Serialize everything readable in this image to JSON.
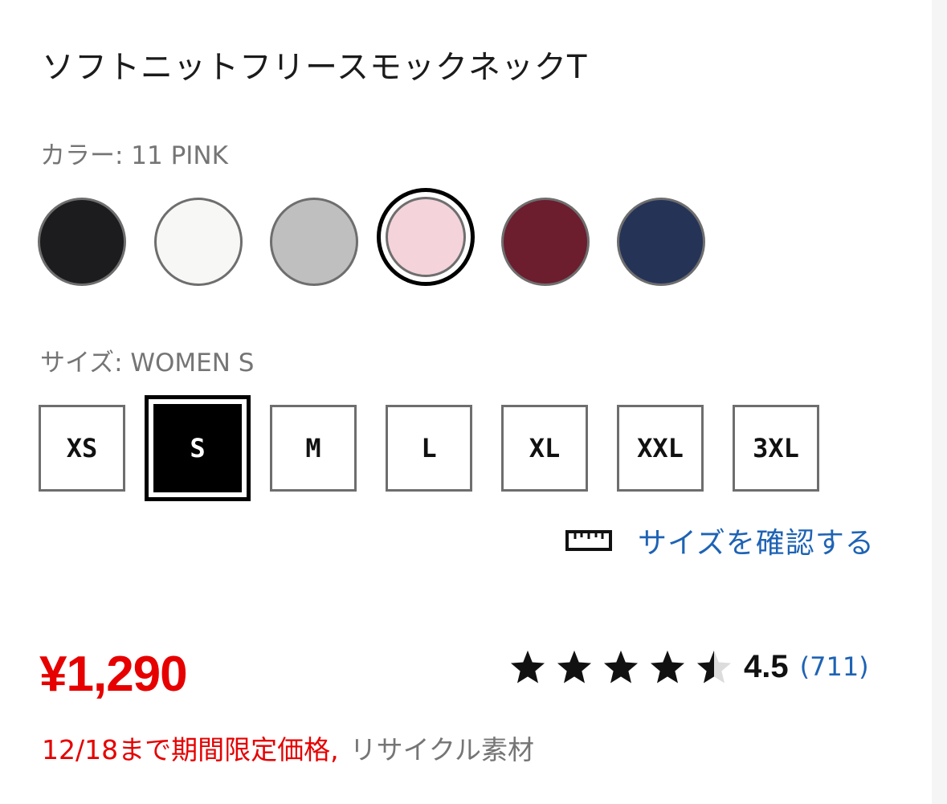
{
  "product": {
    "title": "ソフトニットフリースモックネックT"
  },
  "color": {
    "label": "カラー: 11 PINK",
    "selected_index": 3,
    "swatches": [
      {
        "name": "black",
        "hex": "#1c1c1e"
      },
      {
        "name": "off-white",
        "hex": "#f7f7f5"
      },
      {
        "name": "gray",
        "hex": "#bfbfbf"
      },
      {
        "name": "pink",
        "hex": "#f4d3db"
      },
      {
        "name": "wine",
        "hex": "#6c1d2e"
      },
      {
        "name": "navy",
        "hex": "#253357"
      }
    ]
  },
  "size": {
    "label": "サイズ: WOMEN S",
    "selected_index": 1,
    "options": [
      "XS",
      "S",
      "M",
      "L",
      "XL",
      "XXL",
      "3XL"
    ],
    "check_link": "サイズを確認する",
    "check_icon": "ruler-icon"
  },
  "pricing": {
    "price": "¥1,290",
    "price_color": "#e60000"
  },
  "rating": {
    "stars": 4.5,
    "score": "4.5",
    "count": "(711)",
    "link_color": "#1e63b4"
  },
  "notes": {
    "promo": "12/18まで期間限定価格,",
    "material": "リサイクル素材"
  }
}
